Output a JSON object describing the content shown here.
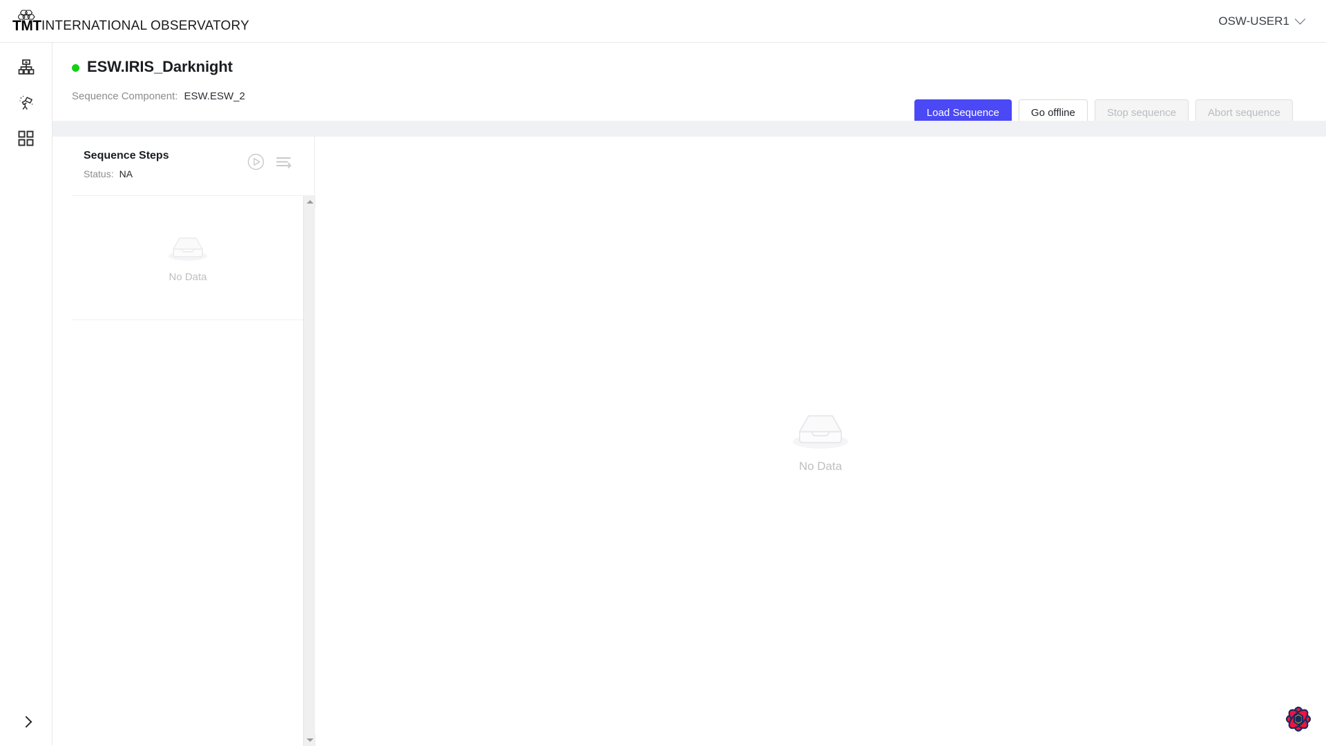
{
  "topbar": {
    "logo_mark": "hexagon-segments-icon",
    "logo_abbrev": "TMT",
    "logo_text": "INTERNATIONAL OBSERVATORY",
    "user": "OSW-USER1",
    "user_chevron": "chevron-down-icon"
  },
  "rail": {
    "items": [
      {
        "icon": "sitemap-icon",
        "name": "resources"
      },
      {
        "icon": "telescope-icon",
        "name": "observations"
      },
      {
        "icon": "grid-apps-icon",
        "name": "apps"
      }
    ],
    "expand_icon": "chevron-right-icon"
  },
  "header": {
    "status_dot_color": "#14d014",
    "title": "ESW.IRIS_Darknight",
    "component_label": "Sequence Component:",
    "component_value": "ESW.ESW_2",
    "buttons": [
      {
        "label": "Load Sequence",
        "style": "primary",
        "disabled": false
      },
      {
        "label": "Go offline",
        "style": "default",
        "disabled": false
      },
      {
        "label": "Stop sequence",
        "style": "default",
        "disabled": true
      },
      {
        "label": "Abort sequence",
        "style": "default",
        "disabled": true
      }
    ]
  },
  "steps_panel": {
    "title": "Sequence Steps",
    "status_label": "Status:",
    "status_value": "NA",
    "play_icon": "play-circle-icon",
    "queue_icon": "step-list-icon",
    "empty_text": "No Data",
    "scroll_up_icon": "scroll-up-arrow-icon",
    "scroll_down_icon": "scroll-down-arrow-icon"
  },
  "main_pane": {
    "empty_text": "No Data",
    "empty_icon": "empty-box-icon"
  },
  "badge": {
    "name": "msw-flower-badge",
    "petal_color": "#f0143c",
    "outline_color": "#1b2a5e",
    "center_color": "#f5e400"
  },
  "colors": {
    "primary": "#4b48f5",
    "strip": "#f0f1f4",
    "border": "#e8e8e8",
    "muted_text": "#8c8c8c",
    "empty_text": "#bfbfbf"
  }
}
